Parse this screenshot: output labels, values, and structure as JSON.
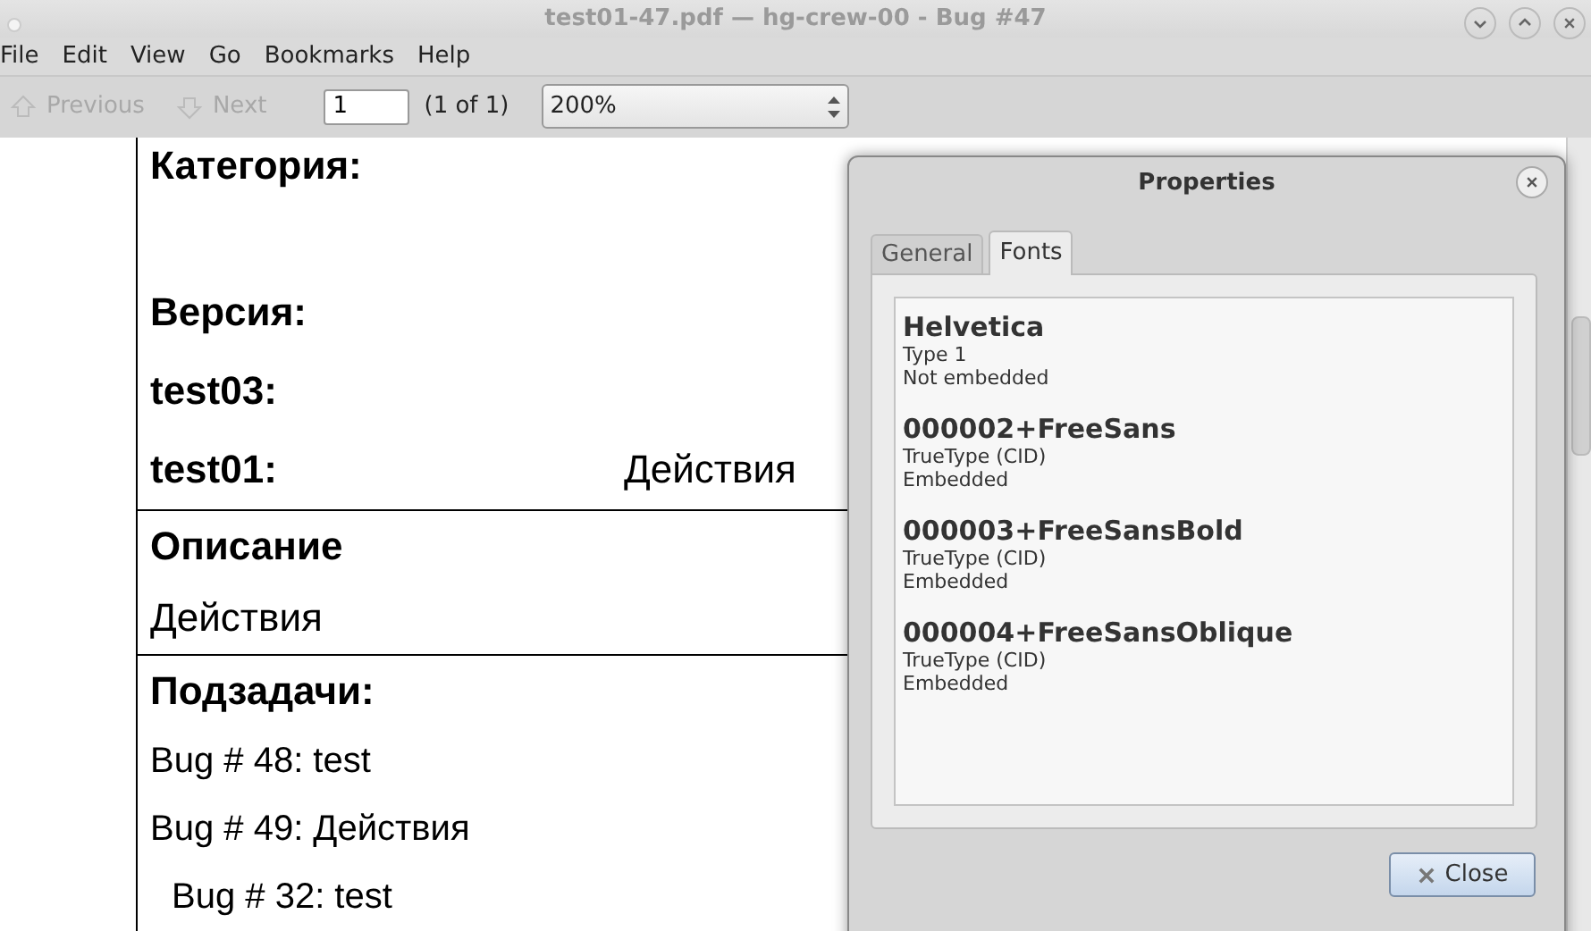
{
  "window": {
    "title": "test01-47.pdf — hg-crew-00 - Bug #47"
  },
  "menu": [
    "File",
    "Edit",
    "View",
    "Go",
    "Bookmarks",
    "Help"
  ],
  "toolbar": {
    "previous": {
      "label": "Previous",
      "disabled": true
    },
    "next": {
      "label": "Next",
      "disabled": true
    },
    "page": {
      "value": "1"
    },
    "page_count": "(1 of 1)",
    "zoom": {
      "value": "200%"
    }
  },
  "document": {
    "fields": [
      {
        "label": "Категория:"
      },
      {
        "label": "Версия:"
      },
      {
        "label": "test03:"
      },
      {
        "label": "test01:",
        "value": "Действия"
      }
    ],
    "description": {
      "heading": "Описание",
      "text": "Действия"
    },
    "subtasks": {
      "heading": "Подзадачи:",
      "items": [
        {
          "text": "Bug # 48: test"
        },
        {
          "text": "Bug # 49: Действия",
          "children": [
            {
              "text": "Bug # 32: test"
            }
          ]
        }
      ]
    }
  },
  "dialog": {
    "title": "Properties",
    "tabs": [
      {
        "label": "General",
        "selected": false
      },
      {
        "label": "Fonts",
        "selected": true
      }
    ],
    "fonts": [
      {
        "name": "Helvetica",
        "type": "Type 1",
        "embedding": "Not embedded"
      },
      {
        "name": "000002+FreeSans",
        "type": "TrueType (CID)",
        "embedding": "Embedded"
      },
      {
        "name": "000003+FreeSansBold",
        "type": "TrueType (CID)",
        "embedding": "Embedded"
      },
      {
        "name": "000004+FreeSansOblique",
        "type": "TrueType (CID)",
        "embedding": "Embedded"
      }
    ],
    "close_button": "Close"
  }
}
